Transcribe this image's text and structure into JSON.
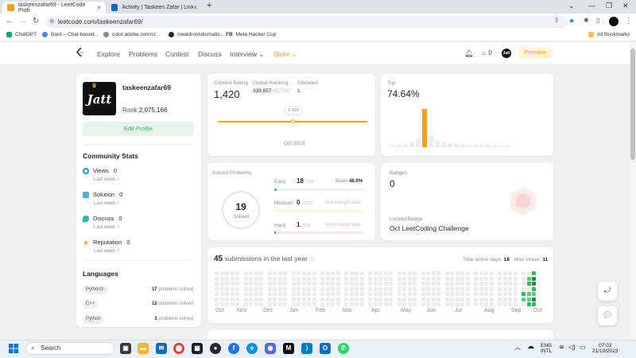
{
  "browser": {
    "tabs": [
      {
        "title": "taskeenzafar69 - LeetCode Profi",
        "close": "×"
      },
      {
        "title": "Activity | Taskeen Zafar | LinkedI",
        "close": "×"
      }
    ],
    "new_tab": "+",
    "window_controls": {
      "minimize": "—",
      "restore": "❐",
      "close": "✕",
      "tab_search": "⌄"
    },
    "url": "leetcode.com/taskeenzafar69/",
    "bookmarks": [
      "ChatGPT",
      "Bard – Chat-based...",
      "color.adobe.com/cr...",
      "nwaldron/idiomatic...",
      "Meta Hacker Cup"
    ],
    "bookmark_fb_prefix": "FB",
    "all_bookmarks": "All Bookmarks"
  },
  "nav": {
    "links": [
      "Explore",
      "Problems",
      "Contest",
      "Discuss",
      "Interview",
      "Store"
    ],
    "streak": "0",
    "avatar_text": "Jatt",
    "premium": "Premium"
  },
  "profile": {
    "username": "taskeenzafar69",
    "avatar_text": "Jatt",
    "rank_label": "Rank",
    "rank": "2,075,166",
    "edit_profile": "Edit Profile"
  },
  "community": {
    "title": "Community Stats",
    "stats": [
      {
        "label": "Views",
        "value": "0",
        "sub_label": "Last week",
        "sub_value": "0",
        "color": "#1890ff"
      },
      {
        "label": "Solution",
        "value": "0",
        "sub_label": "Last week",
        "sub_value": "0",
        "color": "#43b4e5"
      },
      {
        "label": "Discuss",
        "value": "0",
        "sub_label": "Last week",
        "sub_value": "0",
        "color": "#2db5a5"
      },
      {
        "label": "Reputation",
        "value": "0",
        "sub_label": "Last week",
        "sub_value": "0",
        "color": "#ffa116"
      }
    ]
  },
  "languages": {
    "title": "Languages",
    "items": [
      {
        "name": "Python3",
        "count": "17",
        "suffix": "problems solved"
      },
      {
        "name": "C++",
        "count": "12",
        "suffix": "problems solved"
      },
      {
        "name": "Python",
        "count": "3",
        "suffix": "problems solved"
      }
    ]
  },
  "contest": {
    "rating_label": "Contest Rating",
    "rating": "1,420",
    "global_label": "Global Ranking",
    "global_rank": "338,857",
    "global_total": "/457,067",
    "attended_label": "Attended",
    "attended": "1",
    "tooltip": "1,420",
    "date": "Oct 2023",
    "top_label": "Top",
    "top_percent": "74.64%",
    "histogram": [
      2,
      3,
      4,
      6,
      10,
      46,
      14,
      8,
      6,
      5,
      4,
      4,
      3,
      3,
      3,
      3,
      2,
      2,
      2
    ],
    "highlight_index": 5,
    "highlight_color": "#ffa116"
  },
  "solved": {
    "title": "Solved Problems",
    "total": "19",
    "total_label": "Solved",
    "beats_label": "Beats",
    "beats": "48.9%",
    "not_enough": "Not enough data",
    "easy": {
      "label": "Easy",
      "solved": "18",
      "total": "/739",
      "progress": 0.024,
      "color": "#2cbb5d",
      "bg": "#e6f5ec"
    },
    "medium": {
      "label": "Medium",
      "solved": "0",
      "total": "/1532",
      "progress": 0,
      "color": "#ffb800",
      "bg": "#fff5da"
    },
    "hard": {
      "label": "Hard",
      "solved": "1",
      "total": "/636",
      "progress": 0.002,
      "color": "#ef4743",
      "bg": "#fde8e7"
    }
  },
  "badges": {
    "title": "Badges",
    "count": "0",
    "locked_label": "Locked Badge",
    "locked_name": "Oct LeetCoding Challenge"
  },
  "submissions": {
    "count": "45",
    "text": "submissions in the last year",
    "active_label": "Total active days:",
    "active_days": "18",
    "streak_label": "Max streak:",
    "max_streak": "11",
    "months": [
      "Oct",
      "Nov",
      "Dec",
      "Jan",
      "Feb",
      "Mar",
      "Apr",
      "May",
      "Jun",
      "Jul",
      "Aug",
      "Sep",
      "Oct"
    ]
  },
  "taskbar": {
    "search": "Search",
    "lang_top": "ENG",
    "lang_bottom": "INTL",
    "time": "07:02",
    "date": "21/10/2023"
  }
}
